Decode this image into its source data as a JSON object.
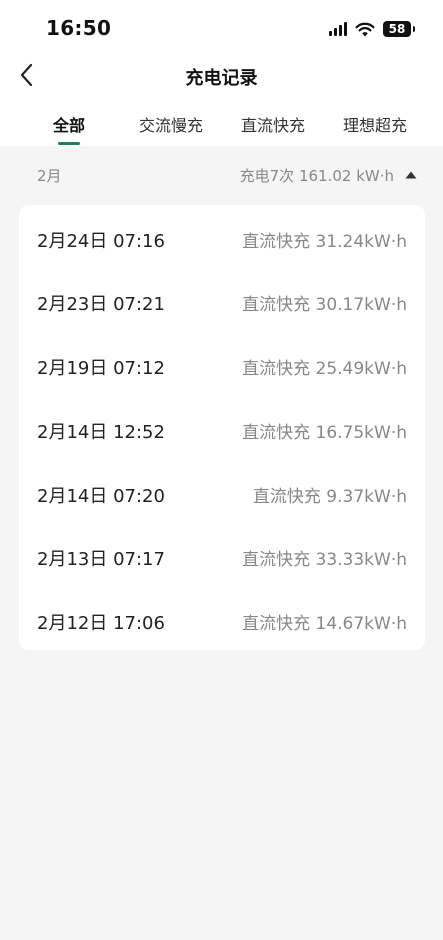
{
  "status_bar": {
    "time": "16:50",
    "battery_level": "58",
    "icons": [
      "cellular-signal-icon",
      "wifi-icon",
      "battery-icon"
    ]
  },
  "nav": {
    "title": "充电记录",
    "back_icon": "chevron-left-icon"
  },
  "tabs": [
    {
      "label": "全部",
      "active": true
    },
    {
      "label": "交流慢充",
      "active": false
    },
    {
      "label": "直流快充",
      "active": false
    },
    {
      "label": "理想超充",
      "active": false
    }
  ],
  "colors": {
    "accent": "#1f7a68",
    "background": "#f5f5f5",
    "card": "#ffffff",
    "secondary_text": "#888888"
  },
  "month_group": {
    "month": "2月",
    "summary": "充电7次 161.02 kW·h",
    "toggle_icon": "caret-up-icon"
  },
  "records": [
    {
      "date": "2月24日 07:16",
      "detail": "直流快充 31.24kW·h"
    },
    {
      "date": "2月23日 07:21",
      "detail": "直流快充 30.17kW·h"
    },
    {
      "date": "2月19日 07:12",
      "detail": "直流快充 25.49kW·h"
    },
    {
      "date": "2月14日 12:52",
      "detail": "直流快充 16.75kW·h"
    },
    {
      "date": "2月14日 07:20",
      "detail": "直流快充 9.37kW·h"
    },
    {
      "date": "2月13日 07:17",
      "detail": "直流快充 33.33kW·h"
    },
    {
      "date": "2月12日 17:06",
      "detail": "直流快充 14.67kW·h"
    }
  ]
}
